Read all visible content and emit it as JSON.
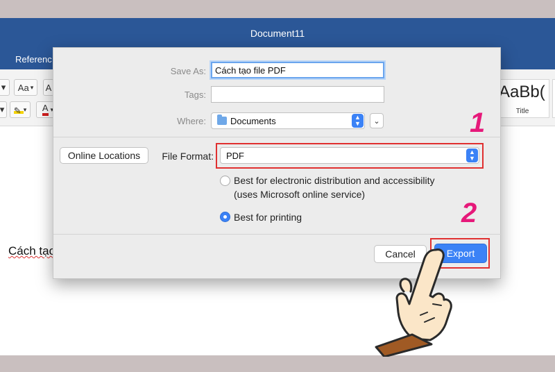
{
  "window": {
    "title": "Document11"
  },
  "ribbon": {
    "tab_label": "Referenc",
    "font_grow_label": "Aa",
    "font_color_label": "A",
    "style_sample": "AaBb(",
    "style_name": "Title"
  },
  "document": {
    "body_text": "Cách tạo"
  },
  "dialog": {
    "save_as_label": "Save As:",
    "save_as_value": "Cách tạo file PDF",
    "tags_label": "Tags:",
    "tags_value": "",
    "where_label": "Where:",
    "where_value": "Documents",
    "online_locations_label": "Online Locations",
    "file_format_label": "File Format:",
    "file_format_value": "PDF",
    "options": [
      {
        "label": "Best for electronic distribution and accessibility (uses Microsoft online service)",
        "line1": "Best for electronic distribution and accessibility",
        "line2": "(uses Microsoft online service)",
        "selected": false
      },
      {
        "label": "Best for printing",
        "selected": true
      }
    ],
    "cancel_label": "Cancel",
    "export_label": "Export"
  },
  "annotations": {
    "step1": "1",
    "step2": "2",
    "highlight_color": "#e03030",
    "number_color": "#e6197a"
  },
  "colors": {
    "titlebar": "#2b5797",
    "accent": "#3b82f6"
  }
}
